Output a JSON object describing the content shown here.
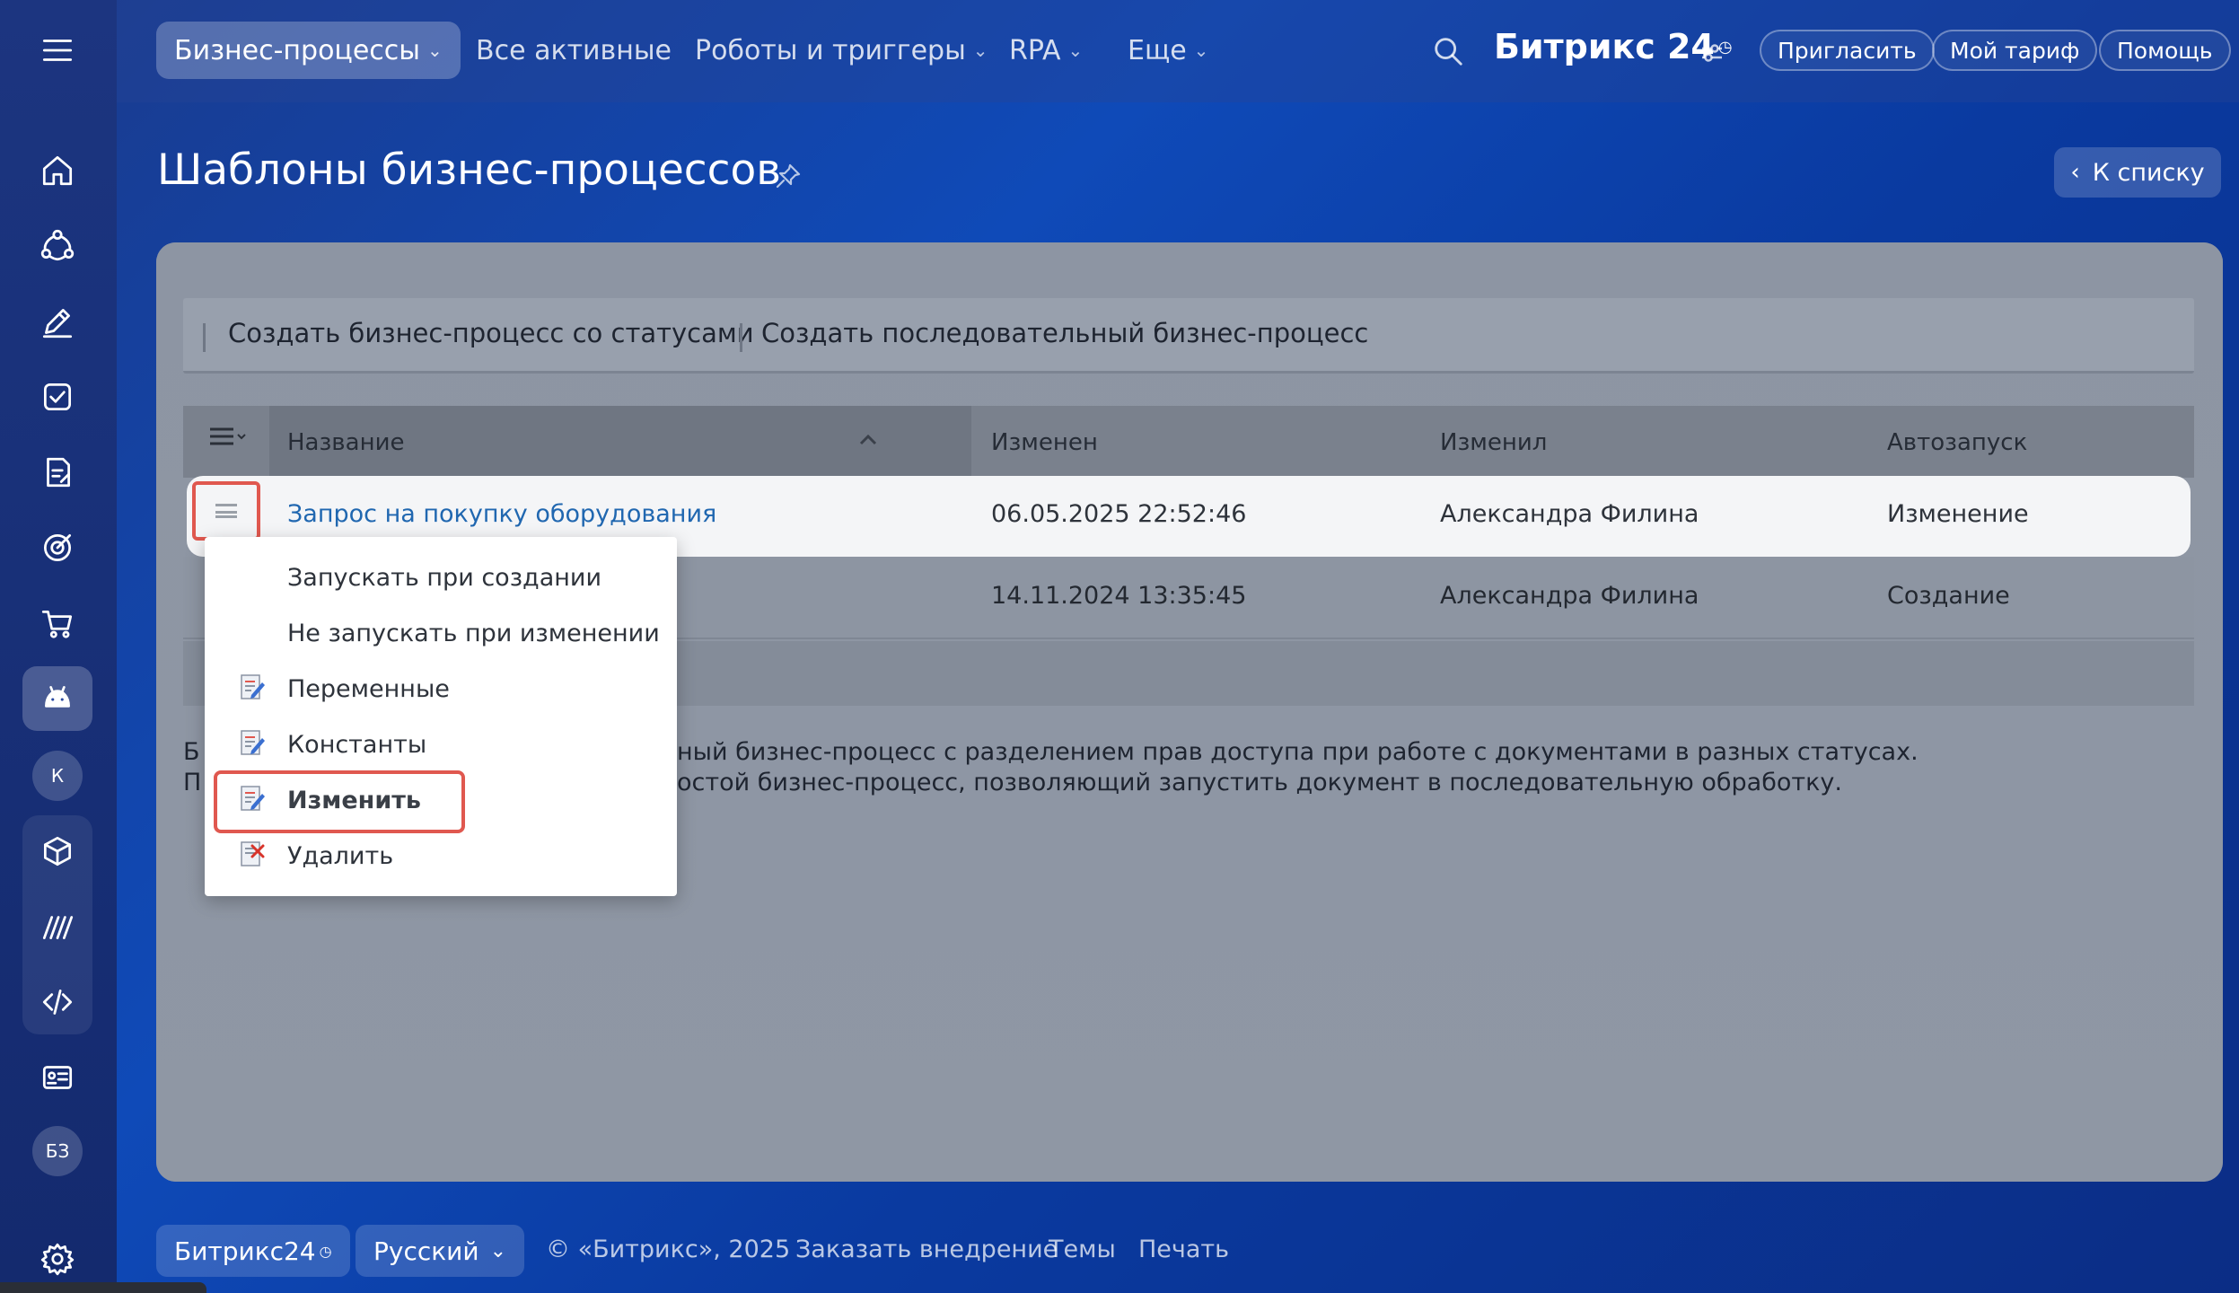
{
  "topnav": {
    "items": [
      {
        "label": "Бизнес-процессы",
        "has_chevron": true,
        "active": true
      },
      {
        "label": "Все активные",
        "has_chevron": false
      },
      {
        "label": "Роботы и триггеры",
        "has_chevron": true
      },
      {
        "label": "RPA",
        "has_chevron": true
      },
      {
        "label": "Еще",
        "has_chevron": true
      }
    ],
    "brand": "Битрикс 24",
    "invite": "Пригласить",
    "tariff": "Мой тариф",
    "help": "Помощь"
  },
  "sidebar": {
    "avatar_k": "К",
    "avatar_bz": "БЗ"
  },
  "page": {
    "title": "Шаблоны бизнес-процессов",
    "back_label": "К списку"
  },
  "toolbar": {
    "create_status": "Создать бизнес-процесс со статусами",
    "create_sequential": "Создать последовательный бизнес-процесс"
  },
  "table": {
    "columns": [
      "Название",
      "Изменен",
      "Изменил",
      "Автозапуск"
    ],
    "rows": [
      {
        "name": "Запрос на покупку оборудования",
        "modified": "06.05.2025 22:52:46",
        "author": "Александра Филина",
        "autostart": "Изменение"
      },
      {
        "name": "",
        "modified": "14.11.2024 13:35:45",
        "author": "Александра Филина",
        "autostart": "Создание"
      }
    ]
  },
  "description": {
    "line1_start": "Б",
    "line1_end": "ный бизнес-процесс с разделением прав доступа при работе с документами в разных статусах.",
    "line2_start": "П",
    "line2_end": "остой бизнес-процесс, позволяющий запустить документ в последовательную обработку."
  },
  "context_menu": {
    "items": [
      {
        "label": "Запускать при создании",
        "icon": null
      },
      {
        "label": "Не запускать при изменении",
        "icon": null
      },
      {
        "label": "Переменные",
        "icon": "edit-doc-icon"
      },
      {
        "label": "Константы",
        "icon": "edit-doc-icon"
      },
      {
        "label": "Изменить",
        "icon": "edit-doc-icon",
        "highlighted": true
      },
      {
        "label": "Удалить",
        "icon": "delete-doc-icon"
      }
    ]
  },
  "footer": {
    "brand": "Битрикс24",
    "language": "Русский",
    "copyright": "© «Битрикс», 2025",
    "order": "Заказать внедрение",
    "themes": "Темы",
    "print": "Печать"
  },
  "colors": {
    "accent_red": "#e0584f",
    "link_blue": "#2067b0"
  }
}
